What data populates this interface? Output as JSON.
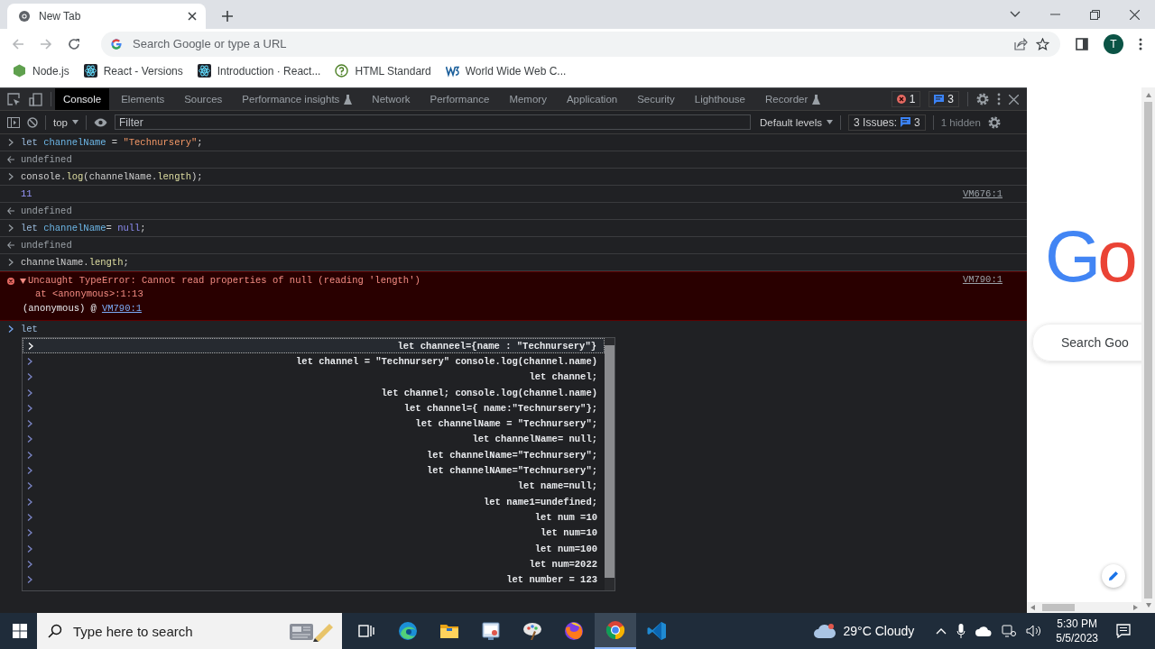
{
  "browser": {
    "tab_title": "New Tab",
    "omnibox": {
      "placeholder": "Search Google or type a URL"
    },
    "profile_initial": "T",
    "bookmarks": [
      {
        "label": "Node.js",
        "kind": "hexagon"
      },
      {
        "label": "React - Versions",
        "kind": "atom"
      },
      {
        "label": "Introduction · React...",
        "kind": "atom"
      },
      {
        "label": "HTML Standard",
        "kind": "question"
      },
      {
        "label": "World Wide Web C...",
        "kind": "zigzag"
      }
    ]
  },
  "devtools": {
    "tabs": [
      {
        "label": "Console",
        "selected": true,
        "experimental": false
      },
      {
        "label": "Elements",
        "selected": false,
        "experimental": false
      },
      {
        "label": "Sources",
        "selected": false,
        "experimental": false
      },
      {
        "label": "Performance insights",
        "selected": false,
        "experimental": true
      },
      {
        "label": "Network",
        "selected": false,
        "experimental": false
      },
      {
        "label": "Performance",
        "selected": false,
        "experimental": false
      },
      {
        "label": "Memory",
        "selected": false,
        "experimental": false
      },
      {
        "label": "Application",
        "selected": false,
        "experimental": false
      },
      {
        "label": "Security",
        "selected": false,
        "experimental": false
      },
      {
        "label": "Lighthouse",
        "selected": false,
        "experimental": false
      },
      {
        "label": "Recorder",
        "selected": false,
        "experimental": true
      }
    ],
    "error_count": "1",
    "message_count": "3",
    "toolbar": {
      "context": "top",
      "filter_placeholder": "Filter",
      "levels": "Default levels",
      "issues_label": "3 Issues:",
      "issues_count": "3",
      "hidden": "1 hidden"
    },
    "console": [
      {
        "kind": "input",
        "code": [
          {
            "text": "let ",
            "kind": "keyword"
          },
          {
            "text": "channelName",
            "kind": "name"
          },
          {
            "text": " = ",
            "kind": "plain"
          },
          {
            "text": "\"Technursery\"",
            "kind": "string"
          },
          {
            "text": ";",
            "kind": "plain"
          }
        ]
      },
      {
        "kind": "result",
        "text": "undefined"
      },
      {
        "kind": "input",
        "code": [
          {
            "text": "console.",
            "kind": "plain"
          },
          {
            "text": "log",
            "kind": "prop"
          },
          {
            "text": "(channelName.",
            "kind": "plain"
          },
          {
            "text": "length",
            "kind": "prop"
          },
          {
            "text": ");",
            "kind": "plain"
          }
        ]
      },
      {
        "kind": "log",
        "text": "11",
        "source": "VM676:1"
      },
      {
        "kind": "result",
        "text": "undefined"
      },
      {
        "kind": "input",
        "code": [
          {
            "text": "let ",
            "kind": "keyword"
          },
          {
            "text": "channelName",
            "kind": "name"
          },
          {
            "text": "= ",
            "kind": "plain"
          },
          {
            "text": "null",
            "kind": "null"
          },
          {
            "text": ";",
            "kind": "plain"
          }
        ]
      },
      {
        "kind": "result",
        "text": "undefined"
      },
      {
        "kind": "input",
        "code": [
          {
            "text": "channelName.",
            "kind": "plain"
          },
          {
            "text": "length",
            "kind": "prop"
          },
          {
            "text": ";",
            "kind": "plain"
          }
        ]
      },
      {
        "kind": "error",
        "expanded": true,
        "message": "Uncaught TypeError: Cannot read properties of null (reading 'length')",
        "stack": "at <anonymous>:1:13",
        "frame": "(anonymous) @",
        "frame_link": "VM790:1",
        "source": "VM790:1"
      }
    ],
    "prompt": {
      "value": "let"
    },
    "autocomplete": [
      {
        "text": "let channeel={name : \"Technursery\"}",
        "selected": true
      },
      {
        "text": "let channel = \"Technursery\" console.log(channel.name)",
        "selected": false
      },
      {
        "text": "let channel;",
        "selected": false
      },
      {
        "text": "let channel; console.log(channel.name)",
        "selected": false
      },
      {
        "text": "let channel={ name:\"Technursery\"};",
        "selected": false
      },
      {
        "text": "let channelName = \"Technursery\";",
        "selected": false
      },
      {
        "text": "let channelName= null;",
        "selected": false
      },
      {
        "text": "let channelName=\"Technursery\";",
        "selected": false
      },
      {
        "text": "let channelNAme=\"Technursery\";",
        "selected": false
      },
      {
        "text": "let name=null;",
        "selected": false
      },
      {
        "text": "let name1=undefined;",
        "selected": false
      },
      {
        "text": "let num =10",
        "selected": false
      },
      {
        "text": "let num=10",
        "selected": false
      },
      {
        "text": "let num=100",
        "selected": false
      },
      {
        "text": "let num=2022",
        "selected": false
      },
      {
        "text": "let number = 123",
        "selected": false
      }
    ]
  },
  "page": {
    "logo": "Go",
    "search_placeholder": "Search Goo"
  },
  "taskbar": {
    "search_placeholder": "Type here to search",
    "apps": [
      {
        "kind": "task_view",
        "selected": false
      },
      {
        "kind": "swirl",
        "selected": false
      },
      {
        "kind": "folder",
        "selected": false
      },
      {
        "kind": "window",
        "selected": false
      },
      {
        "kind": "brush",
        "selected": false
      },
      {
        "kind": "fox",
        "selected": false
      },
      {
        "kind": "ring",
        "selected": true
      },
      {
        "kind": "ribbon",
        "selected": false
      }
    ],
    "weather": "29°C Cloudy",
    "time": "5:30 PM",
    "date": "5/5/2023"
  }
}
